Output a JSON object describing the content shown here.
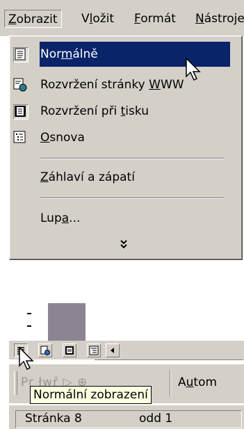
{
  "menubar": {
    "items": [
      {
        "prefix": "",
        "key": "Z",
        "suffix": "obrazit"
      },
      {
        "prefix": "V",
        "key": "l",
        "suffix": "ožit"
      },
      {
        "prefix": "",
        "key": "F",
        "suffix": "ormát"
      },
      {
        "prefix": "",
        "key": "N",
        "suffix": "ástroje"
      }
    ]
  },
  "view_menu": {
    "normal": {
      "prefix": "Nor",
      "key": "m",
      "suffix": "álně",
      "icon": "normal-view-icon"
    },
    "web": {
      "prefix": "Rozvržení stránky ",
      "key": "W",
      "suffix": "WW",
      "icon": "web-layout-icon"
    },
    "print": {
      "prefix": "Rozvržení při ",
      "key": "t",
      "suffix": "isku",
      "icon": "print-layout-icon"
    },
    "outline": {
      "prefix": "",
      "key": "O",
      "suffix": "snova",
      "icon": "outline-view-icon"
    },
    "header_footer": {
      "prefix": "",
      "key": "Z",
      "suffix": "áhlaví a zápatí"
    },
    "zoom": {
      "prefix": "Lup",
      "key": "a",
      "suffix": "..."
    },
    "expand_glyph": "»"
  },
  "toolbar": {
    "faded_text": "Pr  łwř  ▷  ⊕",
    "auto_label_prefix": "A",
    "auto_label_key": "u",
    "auto_label_suffix": "tom"
  },
  "tooltip": "Normální zobrazení",
  "statusbar": {
    "page": "Stránka  8",
    "section": "odd  1"
  },
  "colors": {
    "face": "#d4d0c8",
    "highlight": "#0a246a",
    "tooltip_bg": "#ffffe1",
    "document_grey": "#8c8591"
  }
}
